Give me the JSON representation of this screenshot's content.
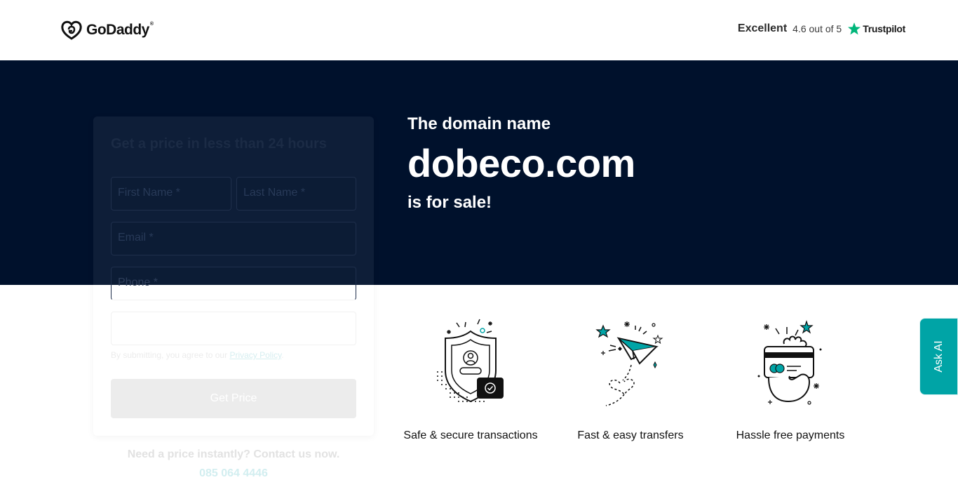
{
  "header": {
    "logo_text": "GoDaddy",
    "logo_tm": "®",
    "rating_label": "Excellent",
    "rating_score": "4.6 out of 5",
    "rating_brand": "Trustpilot"
  },
  "hero": {
    "line1": "The domain name",
    "domain": "dobeco.com",
    "line3": "is for sale!"
  },
  "form": {
    "title": "Get a price in less than 24 hours",
    "first_name_placeholder": "First Name *",
    "last_name_placeholder": "Last Name *",
    "email_placeholder": "Email *",
    "phone_placeholder": "Phone *",
    "consent_text": "By submitting, you agree to our ",
    "privacy_link": "Privacy Policy",
    "consent_end": ".",
    "submit_label": "Get Price"
  },
  "contact": {
    "prompt": "Need a price instantly? Contact us now.",
    "phone": "085 064 4446"
  },
  "features": [
    {
      "label": "Safe & secure transactions",
      "icon": "shield-icon"
    },
    {
      "label": "Fast & easy transfers",
      "icon": "paper-plane-icon"
    },
    {
      "label": "Hassle free payments",
      "icon": "credit-card-icon"
    }
  ],
  "ask_ai": {
    "label": "Ask AI"
  },
  "colors": {
    "hero_bg": "#00112c",
    "accent": "#00a4a6",
    "trustpilot_star": "#00b67a"
  }
}
